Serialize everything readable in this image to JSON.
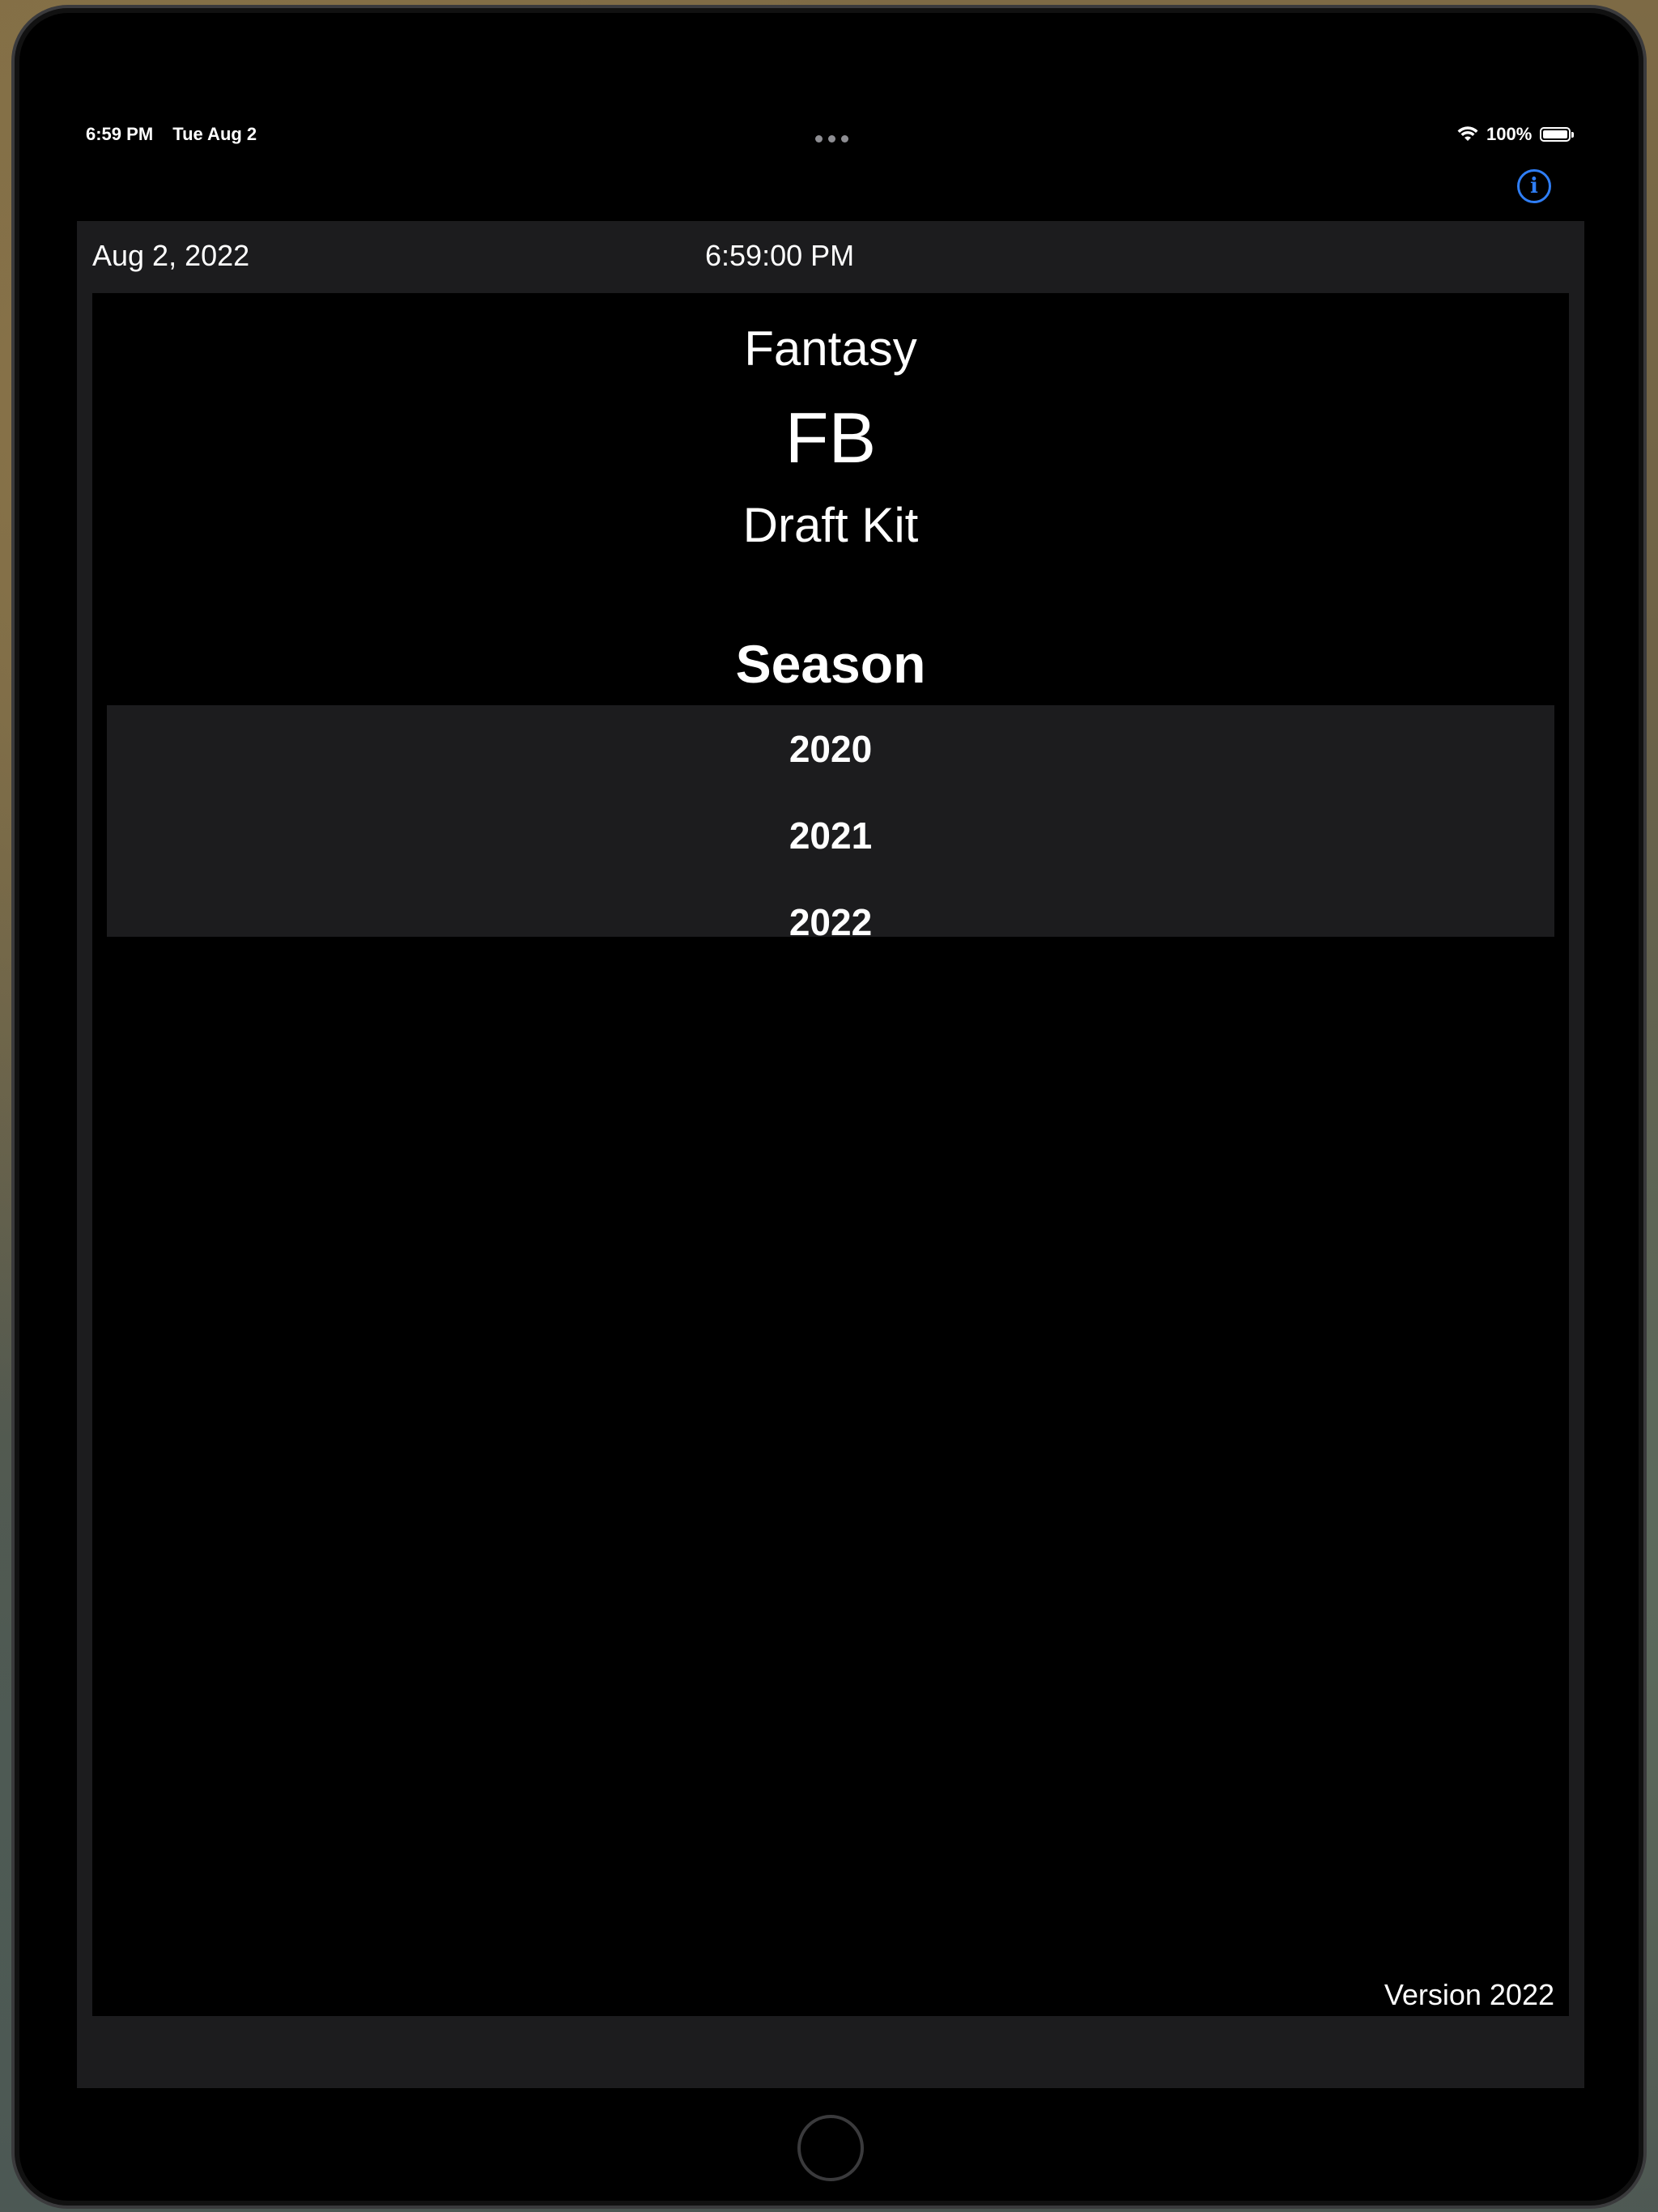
{
  "status_bar": {
    "time": "6:59 PM",
    "date": "Tue Aug 2",
    "battery": "100%",
    "wifi_icon": "wifi-icon",
    "battery_icon": "battery-icon"
  },
  "toolbar": {
    "info_icon": "info-icon",
    "info_glyph": "i",
    "accent_color": "#2f7ef6"
  },
  "header": {
    "date": "Aug 2, 2022",
    "time": "6:59:00 PM"
  },
  "app_title": {
    "line1": "Fantasy",
    "line2": "FB",
    "line3": "Draft Kit"
  },
  "season": {
    "label": "Season",
    "options": [
      "2020",
      "2021",
      "2022"
    ]
  },
  "footer": {
    "version": "Version 2022"
  }
}
